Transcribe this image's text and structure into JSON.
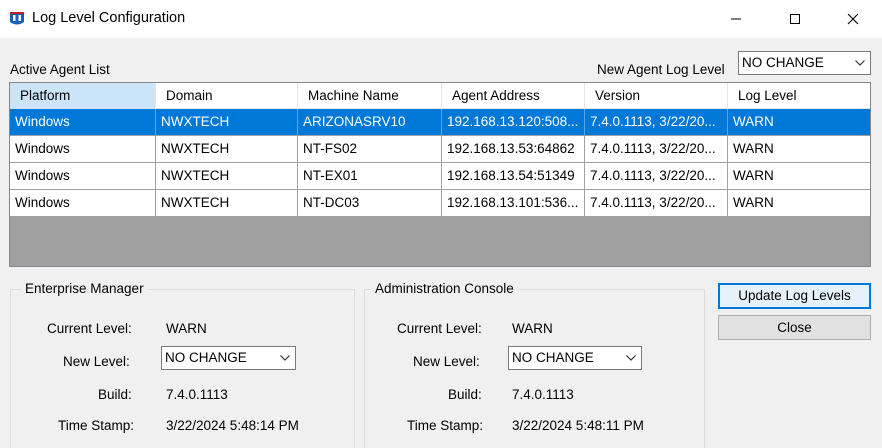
{
  "window": {
    "title": "Log Level Configuration",
    "icons": {
      "app": "app-logo-icon",
      "minimize": "minimize-icon",
      "maximize": "maximize-icon",
      "close": "close-icon"
    }
  },
  "agents": {
    "list_label": "Active Agent List",
    "new_level_label": "New Agent Log Level",
    "new_level_value": "NO CHANGE",
    "columns": [
      "Platform",
      "Domain",
      "Machine Name",
      "Agent Address",
      "Version",
      "Log Level"
    ],
    "rows": [
      [
        "Windows",
        "NWXTECH",
        "ARIZONASRV10",
        "192.168.13.120:508...",
        "7.4.0.1113, 3/22/20...",
        "WARN"
      ],
      [
        "Windows",
        "NWXTECH",
        "NT-FS02",
        "192.168.13.53:64862",
        "7.4.0.1113, 3/22/20...",
        "WARN"
      ],
      [
        "Windows",
        "NWXTECH",
        "NT-EX01",
        "192.168.13.54:51349",
        "7.4.0.1113, 3/22/20...",
        "WARN"
      ],
      [
        "Windows",
        "NWXTECH",
        "NT-DC03",
        "192.168.13.101:536...",
        "7.4.0.1113, 3/22/20...",
        "WARN"
      ]
    ],
    "selected_row": 1
  },
  "enterprise": {
    "title": "Enterprise Manager",
    "current_label": "Current Level:",
    "current_value": "WARN",
    "new_label": "New Level:",
    "new_value": "NO CHANGE",
    "build_label": "Build:",
    "build_value": "7.4.0.1113",
    "timestamp_label": "Time Stamp:",
    "timestamp_value": "3/22/2024 5:48:14 PM"
  },
  "admin": {
    "title": "Administration Console",
    "current_label": "Current Level:",
    "current_value": "WARN",
    "new_label": "New Level:",
    "new_value": "NO CHANGE",
    "build_label": "Build:",
    "build_value": "7.4.0.1113",
    "timestamp_label": "Time Stamp:",
    "timestamp_value": "3/22/2024 5:48:11 PM"
  },
  "buttons": {
    "update": "Update Log Levels",
    "close": "Close"
  },
  "colors": {
    "selection": "#0078d7",
    "header_active": "#cce4f7",
    "grid_empty": "#a0a0a0",
    "window_bg": "#f0f0f0"
  }
}
